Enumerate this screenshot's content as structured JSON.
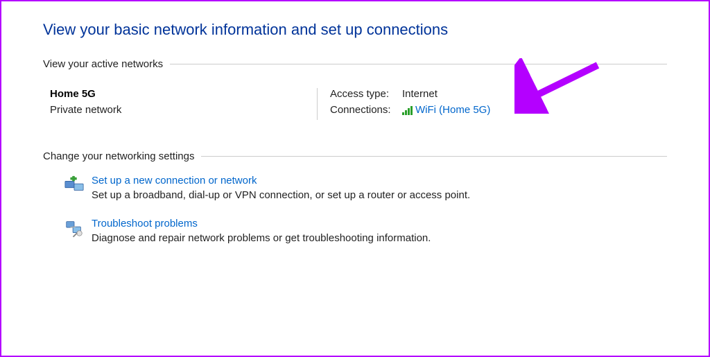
{
  "title": "View your basic network information and set up connections",
  "activeNetworks": {
    "header": "View your active networks",
    "name": "Home 5G",
    "type": "Private network",
    "accessLabel": "Access type:",
    "accessValue": "Internet",
    "connectionsLabel": "Connections:",
    "wifiLink": "WiFi (Home 5G)"
  },
  "settings": {
    "header": "Change your networking settings",
    "items": [
      {
        "link": "Set up a new connection or network",
        "desc": "Set up a broadband, dial-up or VPN connection, or set up a router or access point."
      },
      {
        "link": "Troubleshoot problems",
        "desc": "Diagnose and repair network problems or get troubleshooting information."
      }
    ]
  },
  "colors": {
    "link": "#0066cc",
    "heading": "#003399",
    "arrow": "#b400ff"
  }
}
